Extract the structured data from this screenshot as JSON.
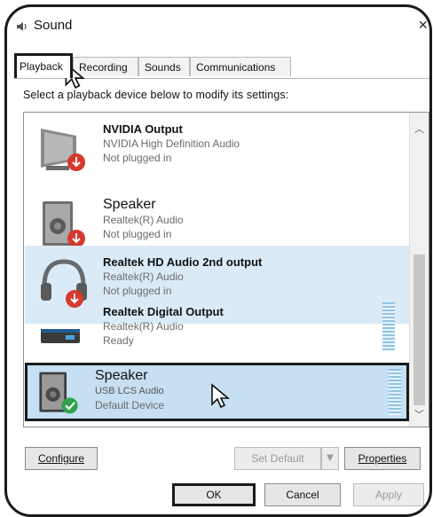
{
  "window": {
    "title": "Sound",
    "close_glyph": "×",
    "icon": "speaker-icon"
  },
  "tabs": [
    {
      "label": "Playback",
      "active": true
    },
    {
      "label": "Recording",
      "active": false
    },
    {
      "label": "Sounds",
      "active": false
    },
    {
      "label": "Communications",
      "active": false
    }
  ],
  "instruction": "Select a playback device below to modify its settings:",
  "devices": [
    {
      "name": "NVIDIA Output",
      "line1": "NVIDIA High Definition Audio",
      "line2": "Not plugged in",
      "icon": "monitor-icon",
      "status_icon": "unplugged-icon"
    },
    {
      "name": "Speaker",
      "line1": "Realtek(R) Audio",
      "line2": "Not plugged in",
      "icon": "speaker-icon",
      "status_icon": "unplugged-icon"
    },
    {
      "name": "Realtek HD Audio 2nd output",
      "line1": "Realtek(R) Audio",
      "line2": "Not plugged in",
      "icon": "headphones-icon",
      "status_icon": "unplugged-icon"
    },
    {
      "name": "Realtek Digital Output",
      "line1": "Realtek(R) Audio",
      "line2": "Ready",
      "icon": "digital-output-icon"
    },
    {
      "name": "Speaker",
      "line1": "USB LCS Audio",
      "line2": "Default Device",
      "icon": "speaker-icon",
      "status_icon": "default-check-icon",
      "selected": true
    }
  ],
  "buttons": {
    "configure": "Configure",
    "set_default": "Set Default",
    "properties": "Properties",
    "ok": "OK",
    "cancel": "Cancel",
    "apply": "Apply"
  },
  "colors": {
    "selection": "#c6dff2",
    "highlight": "#dbeaf7",
    "outline": "#1a1a1a",
    "unplugged_red": "#d63a2f",
    "default_green": "#2fa34a"
  }
}
